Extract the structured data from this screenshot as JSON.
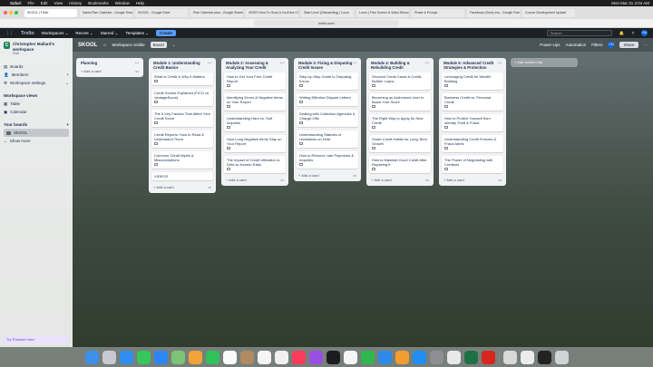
{
  "menubar": {
    "apple": "",
    "items": [
      "Safari",
      "File",
      "Edit",
      "View",
      "History",
      "Bookmarks",
      "Window",
      "Help"
    ],
    "clock": "Mon Mar 31  3:04 AM"
  },
  "browser": {
    "tabs": [
      "SKOOL | Trello",
      "Santa Plan Calendar - Google Sheets",
      "SKOOL - Google Drive",
      "Plan Calendar plan - Google Sheets",
      "VIDEO How To Grow A YouTube Chan...",
      "Start Level (Onboarding) | Loom",
      "Loom | Free Screen & Video Recordi...",
      "Picker & Prompt",
      "Facebook (Gerd) ess - Google Sheets",
      "Course Development Update"
    ],
    "url": "trello.com"
  },
  "trello_header": {
    "logo": "Trello",
    "menus": [
      "Workspaces ⌄",
      "Recent ⌄",
      "Starred ⌄",
      "Templates ⌄"
    ],
    "create": "Create",
    "search_placeholder": "Search",
    "avatar": "CM"
  },
  "sidebar": {
    "workspace_initial": "C",
    "workspace_name": "Christopher Mallard's workspace",
    "workspace_plan": "Free",
    "items": [
      {
        "label": "Boards",
        "icon": "board-icon"
      },
      {
        "label": "Members",
        "icon": "members-icon",
        "action": "+"
      },
      {
        "label": "Workspace settings",
        "icon": "gear-icon",
        "action": "⌄"
      }
    ],
    "views_title": "Workspace views",
    "views": [
      {
        "label": "Table",
        "icon": "table-icon"
      },
      {
        "label": "Calendar",
        "icon": "calendar-icon"
      }
    ],
    "boards_title": "Your boards",
    "boards_action": "+",
    "boards": [
      "SKOOL"
    ],
    "show_more": "Show more",
    "premium": "Try Premium free"
  },
  "board": {
    "title": "SKOOL",
    "visibility": "Workspace visible",
    "view": "Board",
    "power_ups": "Power-Ups",
    "automation": "Automation",
    "filters": "Filters",
    "share": "Share",
    "add_list": "+ Add another list",
    "lists": [
      {
        "title": "Planning",
        "cards": []
      },
      {
        "title": "Module 1: Understanding Credit Basics",
        "cards": [
          "What is Credit & Why It Matters",
          "Credit Scores Explained (FICO vs. VantageScore)",
          "The 5 Key Factors That Affect Your Credit Score",
          "Credit Reports: How to Read & Understand Them",
          "Common Credit Myths & Misconceptions",
          "VIDEOS"
        ]
      },
      {
        "title": "Module 2: Assessing & Analyzing Your Credit",
        "cards": [
          "How to Get Your Free Credit Report",
          "Identifying Errors & Negative Items on Your Report",
          "Understanding Hard vs. Soft Inquiries",
          "How Long Negative Items Stay on Your Report",
          "The Impact of Credit Utilization & Debt-to-Income Ratio"
        ]
      },
      {
        "title": "Module 3: Fixing & Disputing Credit Issues",
        "cards": [
          "Step-by-Step Guide to Disputing Errors",
          "Writing Effective Dispute Letters",
          "Dealing with Collection Agencies & Charge-Offs",
          "Understanding Statutes of Limitations on Debt",
          "How to Remove Late Payments & Inquiries"
        ]
      },
      {
        "title": "Module 4: Building & Rebuilding Credit",
        "cards": [
          "Secured Credit Cards & Credit-Builder Loans",
          "Becoming an Authorized User to Boost Your Score",
          "The Right Way to Apply for New Credit",
          "Smart Credit Habits for Long-Term Growth",
          "How to Maintain Good Credit After Repairing It"
        ]
      },
      {
        "title": "Module 5: Advanced Credit Strategies & Protection",
        "cards": [
          "Leveraging Credit for Wealth Building",
          "Business Credit vs. Personal Credit",
          "How to Protect Yourself from Identity Theft & Fraud",
          "Understanding Credit Freezes & Fraud Alerts",
          "The Power of Negotiating with Creditors"
        ]
      }
    ],
    "add_card": "+ Add a card"
  }
}
